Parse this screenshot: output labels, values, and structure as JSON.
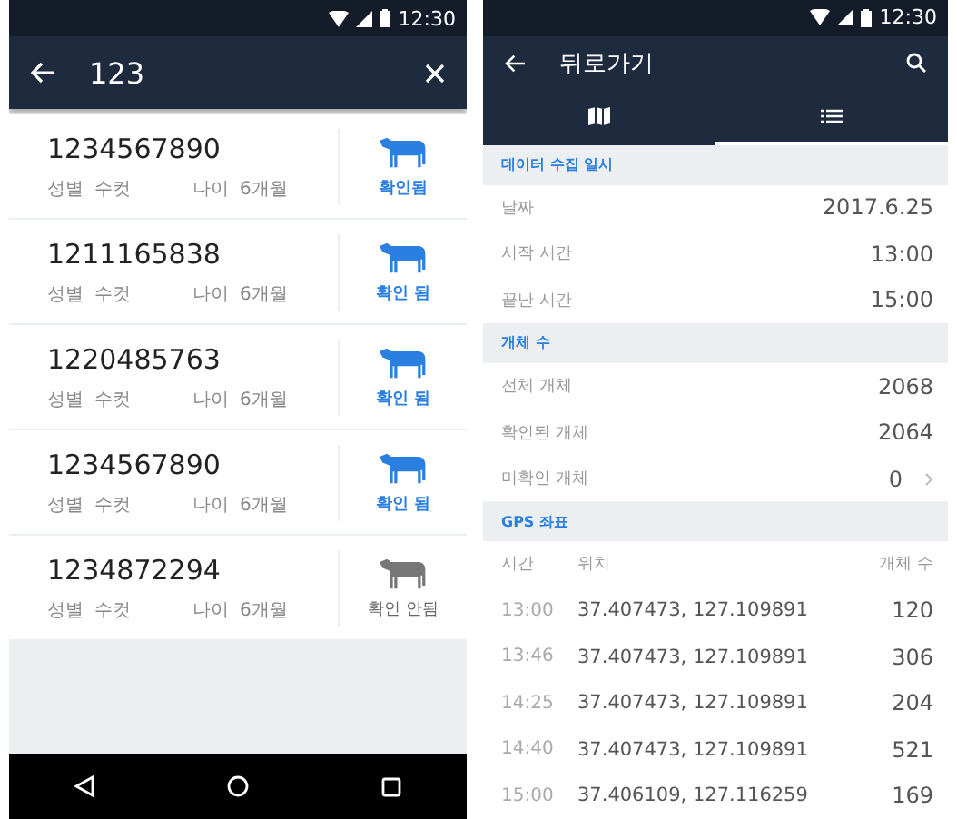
{
  "search_screen": {
    "status_bar": {
      "time": "12:30"
    },
    "search": {
      "value": "123"
    },
    "animals": [
      {
        "id": "1234567890",
        "sex_label": "성별",
        "sex": "수컷",
        "age_label": "나이",
        "age": "6개월",
        "status": "확인됨",
        "verified": true
      },
      {
        "id": "1211165838",
        "sex_label": "성별",
        "sex": "수컷",
        "age_label": "나이",
        "age": "6개월",
        "status": "확인 됨",
        "verified": true
      },
      {
        "id": "1220485763",
        "sex_label": "성별",
        "sex": "수컷",
        "age_label": "나이",
        "age": "6개월",
        "status": "확인 됨",
        "verified": true
      },
      {
        "id": "1234567890",
        "sex_label": "성별",
        "sex": "수컷",
        "age_label": "나이",
        "age": "6개월",
        "status": "확인 됨",
        "verified": true
      },
      {
        "id": "1234872294",
        "sex_label": "성별",
        "sex": "수컷",
        "age_label": "나이",
        "age": "6개월",
        "status": "확인 안됨",
        "verified": false
      }
    ]
  },
  "detail_screen": {
    "status_bar": {
      "time": "12:30"
    },
    "title": "뒤로가기",
    "tabs": [
      {
        "kind": "map",
        "selected": false
      },
      {
        "kind": "list",
        "selected": true
      }
    ],
    "sections": [
      {
        "title": "데이터 수집 일시",
        "rows": [
          {
            "label": "날짜",
            "value": "2017.6.25"
          },
          {
            "label": "시작 시간",
            "value": "13:00"
          },
          {
            "label": "끝난 시간",
            "value": "15:00"
          }
        ]
      },
      {
        "title": "개체 수",
        "rows": [
          {
            "label": "전체 개체",
            "value": "2068"
          },
          {
            "label": "확인된 개체",
            "value": "2064"
          },
          {
            "label": "미확인 개체",
            "value": "0",
            "link": true
          }
        ]
      }
    ],
    "gps": {
      "title": "GPS 좌표",
      "columns": [
        "시간",
        "위치",
        "개체 수"
      ],
      "rows": [
        [
          "13:00",
          "37.407473, 127.109891",
          "120"
        ],
        [
          "13:46",
          "37.407473, 127.109891",
          "306"
        ],
        [
          "14:25",
          "37.407473, 127.109891",
          "204"
        ],
        [
          "14:40",
          "37.407473, 127.109891",
          "521"
        ],
        [
          "15:00",
          "37.406109, 127.116259",
          "169"
        ]
      ]
    }
  }
}
